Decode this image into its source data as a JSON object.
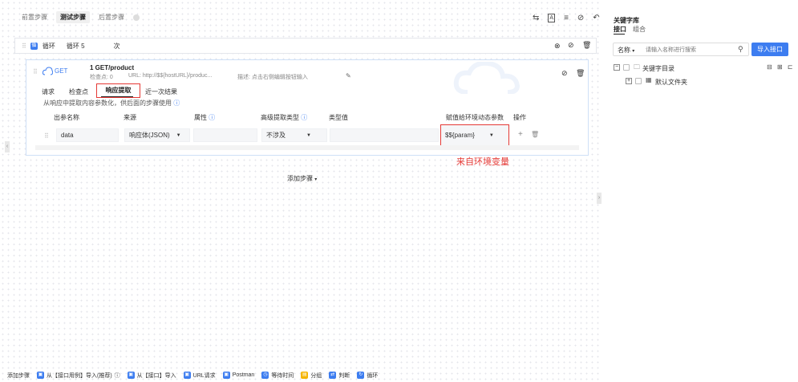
{
  "top_tabs": [
    "前置步骤",
    "测试步骤",
    "后置步骤"
  ],
  "loop": {
    "badge": "循",
    "label": "循环",
    "count_label": "循环 5",
    "unit": "次"
  },
  "request": {
    "method": "GET",
    "index_title": "1  GET/product",
    "checkpoint": "检查点: 0",
    "url": "URL: http://$${hostURL}/produc...",
    "description": "描述:  点击右侧编辑按钮输入"
  },
  "sub_tabs": [
    "请求",
    "检查点",
    "响应提取",
    "近一次结果"
  ],
  "hint": "从响应中提取内容参数化，供后面的步骤使用",
  "table": {
    "headers": [
      "出参名称",
      "来源",
      "属性",
      "高级提取类型",
      "类型值",
      "赋值给环境动态参数",
      "操作"
    ],
    "row": {
      "name": "data",
      "source": "响应体(JSON)",
      "extract_type": "不涉及",
      "env_param": "$${param}"
    }
  },
  "annotation": "来自环境变量",
  "add_step": "添加步骤",
  "bottom_bar": {
    "label": "添加步骤",
    "items": [
      {
        "text": "从【接口用例】导入(推荐)",
        "color": "#3d7df0"
      },
      {
        "text": "从【接口】导入",
        "color": "#3d7df0"
      },
      {
        "text": "URL请求",
        "color": "#3d7df0"
      },
      {
        "text": "Postman",
        "color": "#3d7df0"
      },
      {
        "text": "等待时间",
        "color": "#3d7df0"
      },
      {
        "text": "分组",
        "color": "#f5b400"
      },
      {
        "text": "判断",
        "color": "#3d7df0"
      },
      {
        "text": "循环",
        "color": "#3d7df0"
      }
    ]
  },
  "sidebar": {
    "title": "关键字库",
    "tabs": [
      "接口",
      "组合"
    ],
    "filter_label": "名称",
    "search_placeholder": "请输入名称进行搜索",
    "import_button": "导入接口",
    "tree_root": "关键字目录",
    "tree_child": "默认文件夹"
  },
  "colors": {
    "primary": "#3d7df0",
    "annotation_red": "#e53935"
  }
}
